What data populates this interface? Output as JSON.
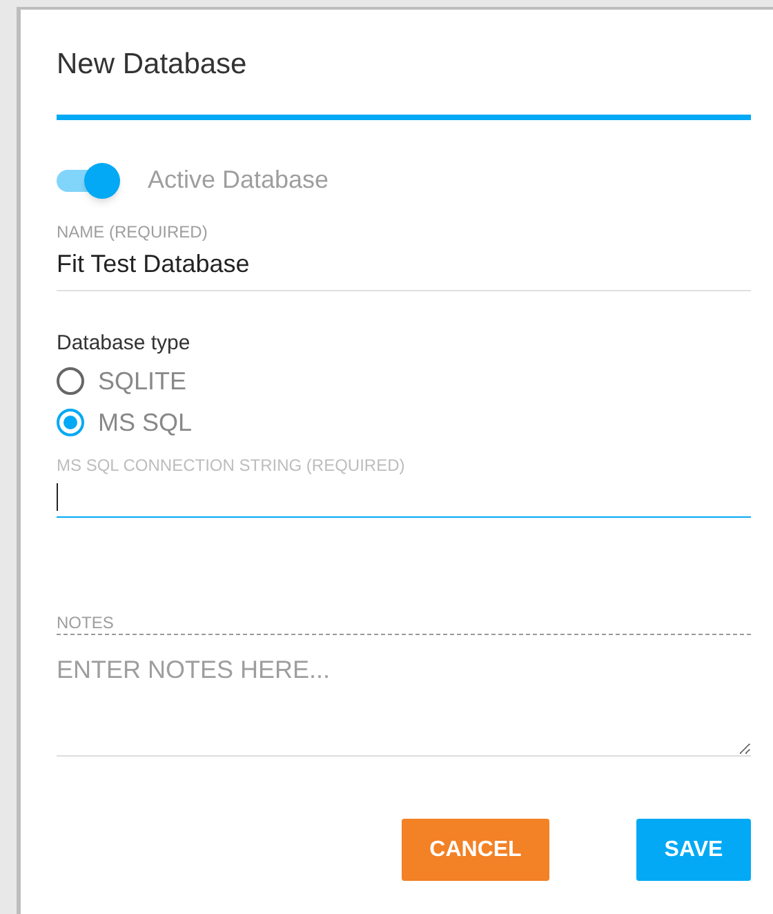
{
  "dialog": {
    "title": "New Database"
  },
  "active_toggle": {
    "label": "Active Database",
    "on": true
  },
  "name_field": {
    "label": "NAME (REQUIRED)",
    "value": "Fit Test Database"
  },
  "database_type": {
    "label": "Database type",
    "options": [
      {
        "label": "SQLITE",
        "selected": false
      },
      {
        "label": "MS SQL",
        "selected": true
      }
    ]
  },
  "connection_field": {
    "label": "MS SQL CONNECTION STRING (REQUIRED)",
    "focused": true
  },
  "notes": {
    "label": "NOTES",
    "placeholder": "ENTER NOTES HERE..."
  },
  "buttons": [
    {
      "label": "CANCEL",
      "kind": "cancel"
    },
    {
      "label": "SAVE",
      "kind": "primary"
    }
  ]
}
